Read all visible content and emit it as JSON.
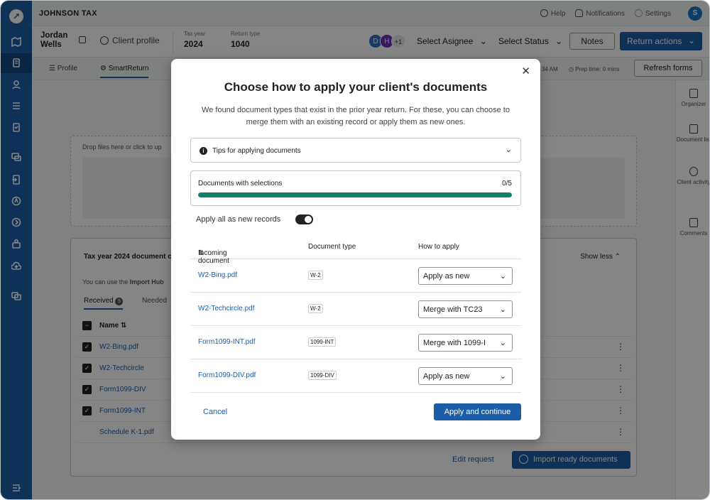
{
  "app": {
    "brand": "JOHNSON TAX",
    "user_initial": "S"
  },
  "top_links": {
    "help": "Help",
    "notifications": "Notifications",
    "settings": "Settings"
  },
  "client": {
    "first_name": "Jordan",
    "last_name": "Wells",
    "profile_label": "Client profile",
    "tax_year_label": "Tax year",
    "tax_year": "2024",
    "return_type_label": "Return type",
    "return_type": "1040",
    "assignees": [
      {
        "initial": "D",
        "color": "#2f6fc4"
      },
      {
        "initial": "H",
        "color": "#6b2fb8"
      }
    ],
    "assignee_more": "+1",
    "select_assignee": "Select Asignee",
    "select_status": "Select Status",
    "notes": "Notes",
    "return_actions": "Return actions"
  },
  "tabs": {
    "profile": "Profile",
    "smartreturn": "SmartReturn",
    "time_partial": "34 AM",
    "prep_time": "Prep time: 0 mins",
    "refresh": "Refresh forms"
  },
  "right_panel": {
    "organizer": "Organizer",
    "document_list": "Document list",
    "client_activity": "Client activity",
    "comments": "Comments"
  },
  "background": {
    "drop_label": "Drop files here or click to up",
    "docs_header": "Tax year 2024 document ch",
    "show_less": "Show less",
    "use_text_a": "You can use the ",
    "use_text_b": "Import Hub",
    "tab_received": "Received",
    "received_count": "5",
    "tab_needed": "Needed",
    "name_col": "Name",
    "rows": [
      "W2-Bing.pdf",
      "W2-Techcircle",
      "Form1099-DIV",
      "Form1099-INT",
      "Schedule K-1.pdf"
    ],
    "edit_request": "Edit request",
    "import_ready": "Import ready documents"
  },
  "modal": {
    "title": "Choose how to apply your client's documents",
    "description": "We found document types that exist in the prior year return. For these, you can choose to merge them with an existing record or apply them as new ones.",
    "tips": "Tips for applying documents",
    "progress_label": "Documents with selections",
    "progress_count": "0/5",
    "progress_fraction": 1.0,
    "toggle_label": "Apply all as new records",
    "toggle_on": true,
    "col_incoming": "Incoming document",
    "col_type": "Document type",
    "col_how": "How to apply",
    "rows": [
      {
        "file": "W2-Bing.pdf",
        "type": "W-2",
        "apply": "Apply as new"
      },
      {
        "file": "W2-Techcircle.pdf",
        "type": "W-2",
        "apply": "Merge with TC23"
      },
      {
        "file": "Form1099-INT.pdf",
        "type": "1099-INT",
        "apply": "Merge with 1099-I"
      },
      {
        "file": "Form1099-DIV.pdf",
        "type": "1099-DIV",
        "apply": "Apply as new"
      }
    ],
    "cancel": "Cancel",
    "apply_continue": "Apply and continue"
  }
}
